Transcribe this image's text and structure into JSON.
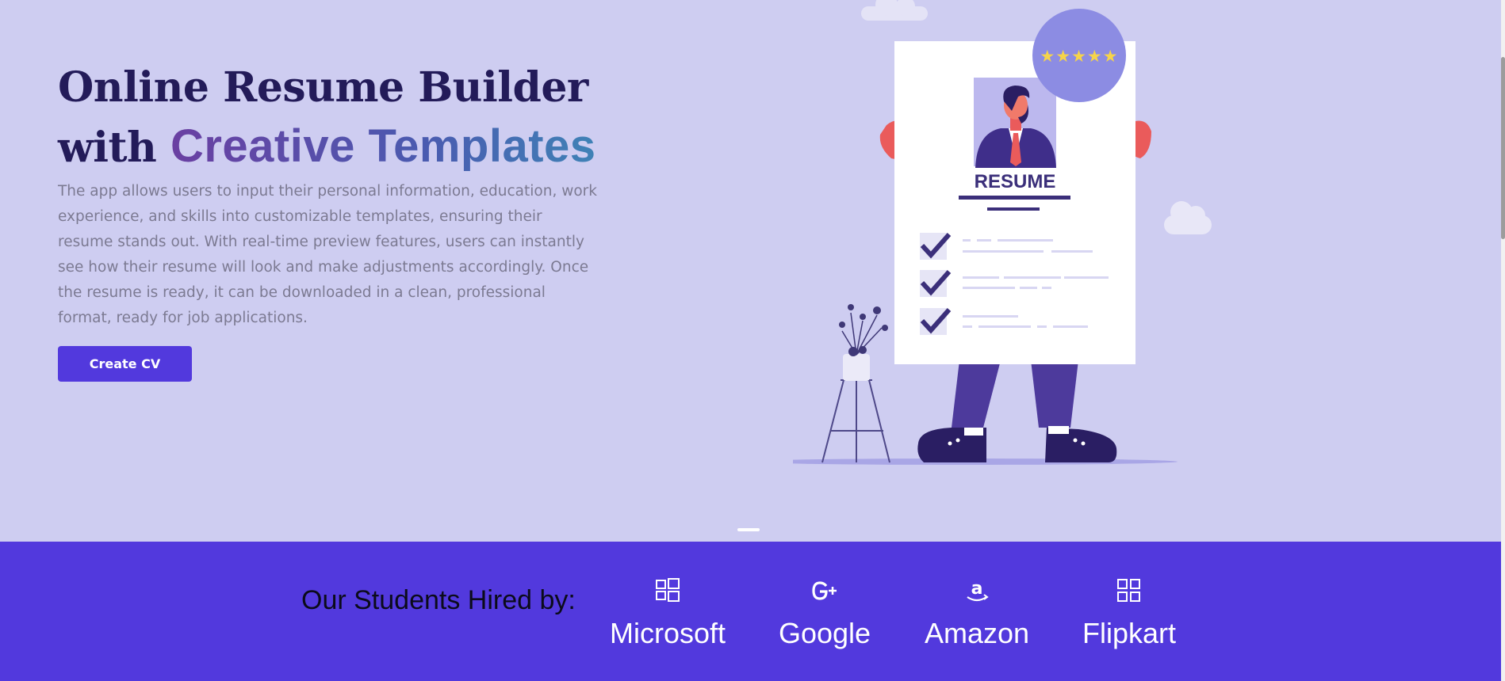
{
  "hero": {
    "title_line1": "Online Resume Builder",
    "title_line2_prefix": "with",
    "title_line2_highlight": "Creative Templates",
    "description": "The app allows users to input their personal information, education, work experience, and skills into customizable templates, ensuring their resume stands out. With real-time preview features, users can instantly see how their resume will look and make adjustments accordingly. Once the resume is ready, it can be downloaded in a clean, professional format, ready for job applications.",
    "cta_label": "Create CV",
    "illustration": {
      "resume_heading": "RESUME",
      "rating_stars": "★★★★★"
    }
  },
  "hired_by": {
    "label": "Our Students Hired by:",
    "companies": [
      {
        "name": "Microsoft",
        "icon": "windows-icon"
      },
      {
        "name": "Google",
        "icon": "google-plus-icon"
      },
      {
        "name": "Amazon",
        "icon": "amazon-icon"
      },
      {
        "name": "Flipkart",
        "icon": "grid-icon"
      }
    ]
  },
  "colors": {
    "hero_background": "#cecdf1",
    "brand_purple": "#5239dd",
    "title_dark": "#231b59"
  }
}
